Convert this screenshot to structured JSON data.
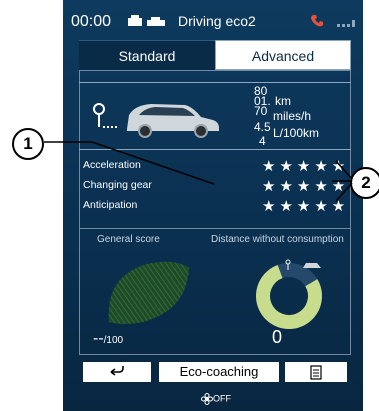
{
  "status": {
    "time": "00:00",
    "title": "Driving eco2",
    "car_icons": "car-settings-icon",
    "phone_icon": "phone-icon",
    "signal_icon": "signal-icon"
  },
  "tabs": [
    {
      "label": "Standard",
      "selected": false
    },
    {
      "label": "Advanced",
      "selected": true
    }
  ],
  "trip": {
    "distance_value": "80",
    "distance_unit": "km",
    "distance_alt_value": "01.",
    "speed_value": "70",
    "speed_unit": "miles/h",
    "consumption_value": "4.5",
    "consumption_alt_value": "4",
    "consumption_unit": "L/100km"
  },
  "scores": [
    {
      "label": "Acceleration",
      "stars": 5,
      "max": 5
    },
    {
      "label": "Changing gear",
      "stars": 5,
      "max": 5
    },
    {
      "label": "Anticipation",
      "stars": 5,
      "max": 5
    }
  ],
  "general_score": {
    "label": "General score",
    "value": "--",
    "max": "/100",
    "leaf_color": "#2f6a2f"
  },
  "distance_without_consumption": {
    "label": "Distance without consumption",
    "value": "0",
    "ring_color": "#c7dc8c",
    "ring_fill_fraction": 0.78
  },
  "bottom_bar": {
    "back_icon": "back-arrow-icon",
    "center_label": "Eco-coaching",
    "list_icon": "list-icon"
  },
  "climate": {
    "fan_icon": "fan-icon",
    "label": "OFF"
  },
  "callouts": {
    "one": "1",
    "two": "2"
  }
}
